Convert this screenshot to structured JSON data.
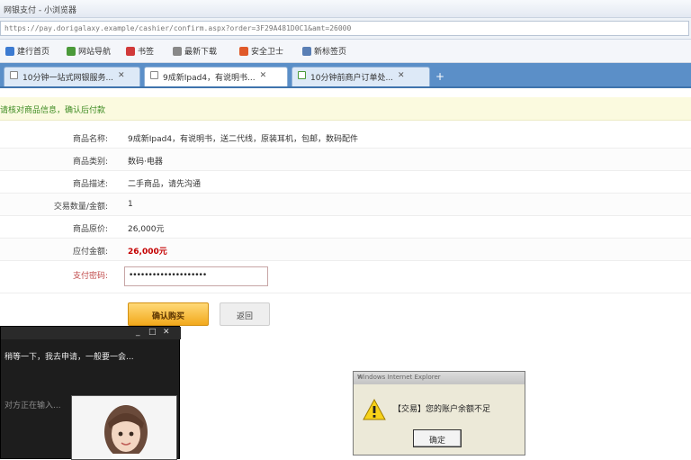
{
  "window": {
    "title": "网银支付 - 小浏览器"
  },
  "address": {
    "url": "https://pay.dorigalaxy.example/cashier/confirm.aspx?order=3F29A481D0C1&amt=26000"
  },
  "favorites": [
    {
      "label": "建行首页",
      "color": "#3d7bd1"
    },
    {
      "label": "网站导航",
      "color": "#4b9a3a"
    },
    {
      "label": "书签",
      "color": "#d13a3a"
    },
    {
      "label": "最新下载",
      "color": "#888888"
    },
    {
      "label": "安全卫士",
      "color": "#e05a2a"
    },
    {
      "label": "新标签页",
      "color": "#5a7fb5"
    }
  ],
  "tabs": [
    {
      "label": "10分钟一站式网银服务...",
      "active": false
    },
    {
      "label": "9成新Ipad4，有说明书...",
      "active": true
    },
    {
      "label": "10分钟前商户订单处...",
      "active": false
    }
  ],
  "notice": "请核对商品信息，确认后付款",
  "form": {
    "rows": [
      {
        "label": "商品名称:",
        "value": "9成新Ipad4，有说明书，送二代线，原装耳机，包邮，数码配件",
        "red": false
      },
      {
        "label": "商品类别:",
        "value": "数码·电器",
        "red": false
      },
      {
        "label": "商品描述:",
        "value": "二手商品，请先沟通",
        "red": false
      },
      {
        "label": "交易数量/金额:",
        "value": "1",
        "red": false
      },
      {
        "label": "商品原价:",
        "value": "26,000元",
        "red": false
      },
      {
        "label": "应付金额:",
        "value": "26,000元",
        "red": true
      },
      {
        "label": "支付密码:",
        "value": "",
        "red": false
      }
    ],
    "password_mask": "••••••••••••••••••••",
    "confirm_label": "确认购买",
    "back_label": "返回"
  },
  "chat": {
    "message": "稍等一下，我去申请，一般要一会...",
    "status": "对方正在输入...",
    "controls": [
      "_",
      "□",
      "✕"
    ]
  },
  "dialog": {
    "title": "Windows Internet Explorer",
    "message": "【交易】您的账户余额不足",
    "ok_label": "确定",
    "close": "✕"
  }
}
